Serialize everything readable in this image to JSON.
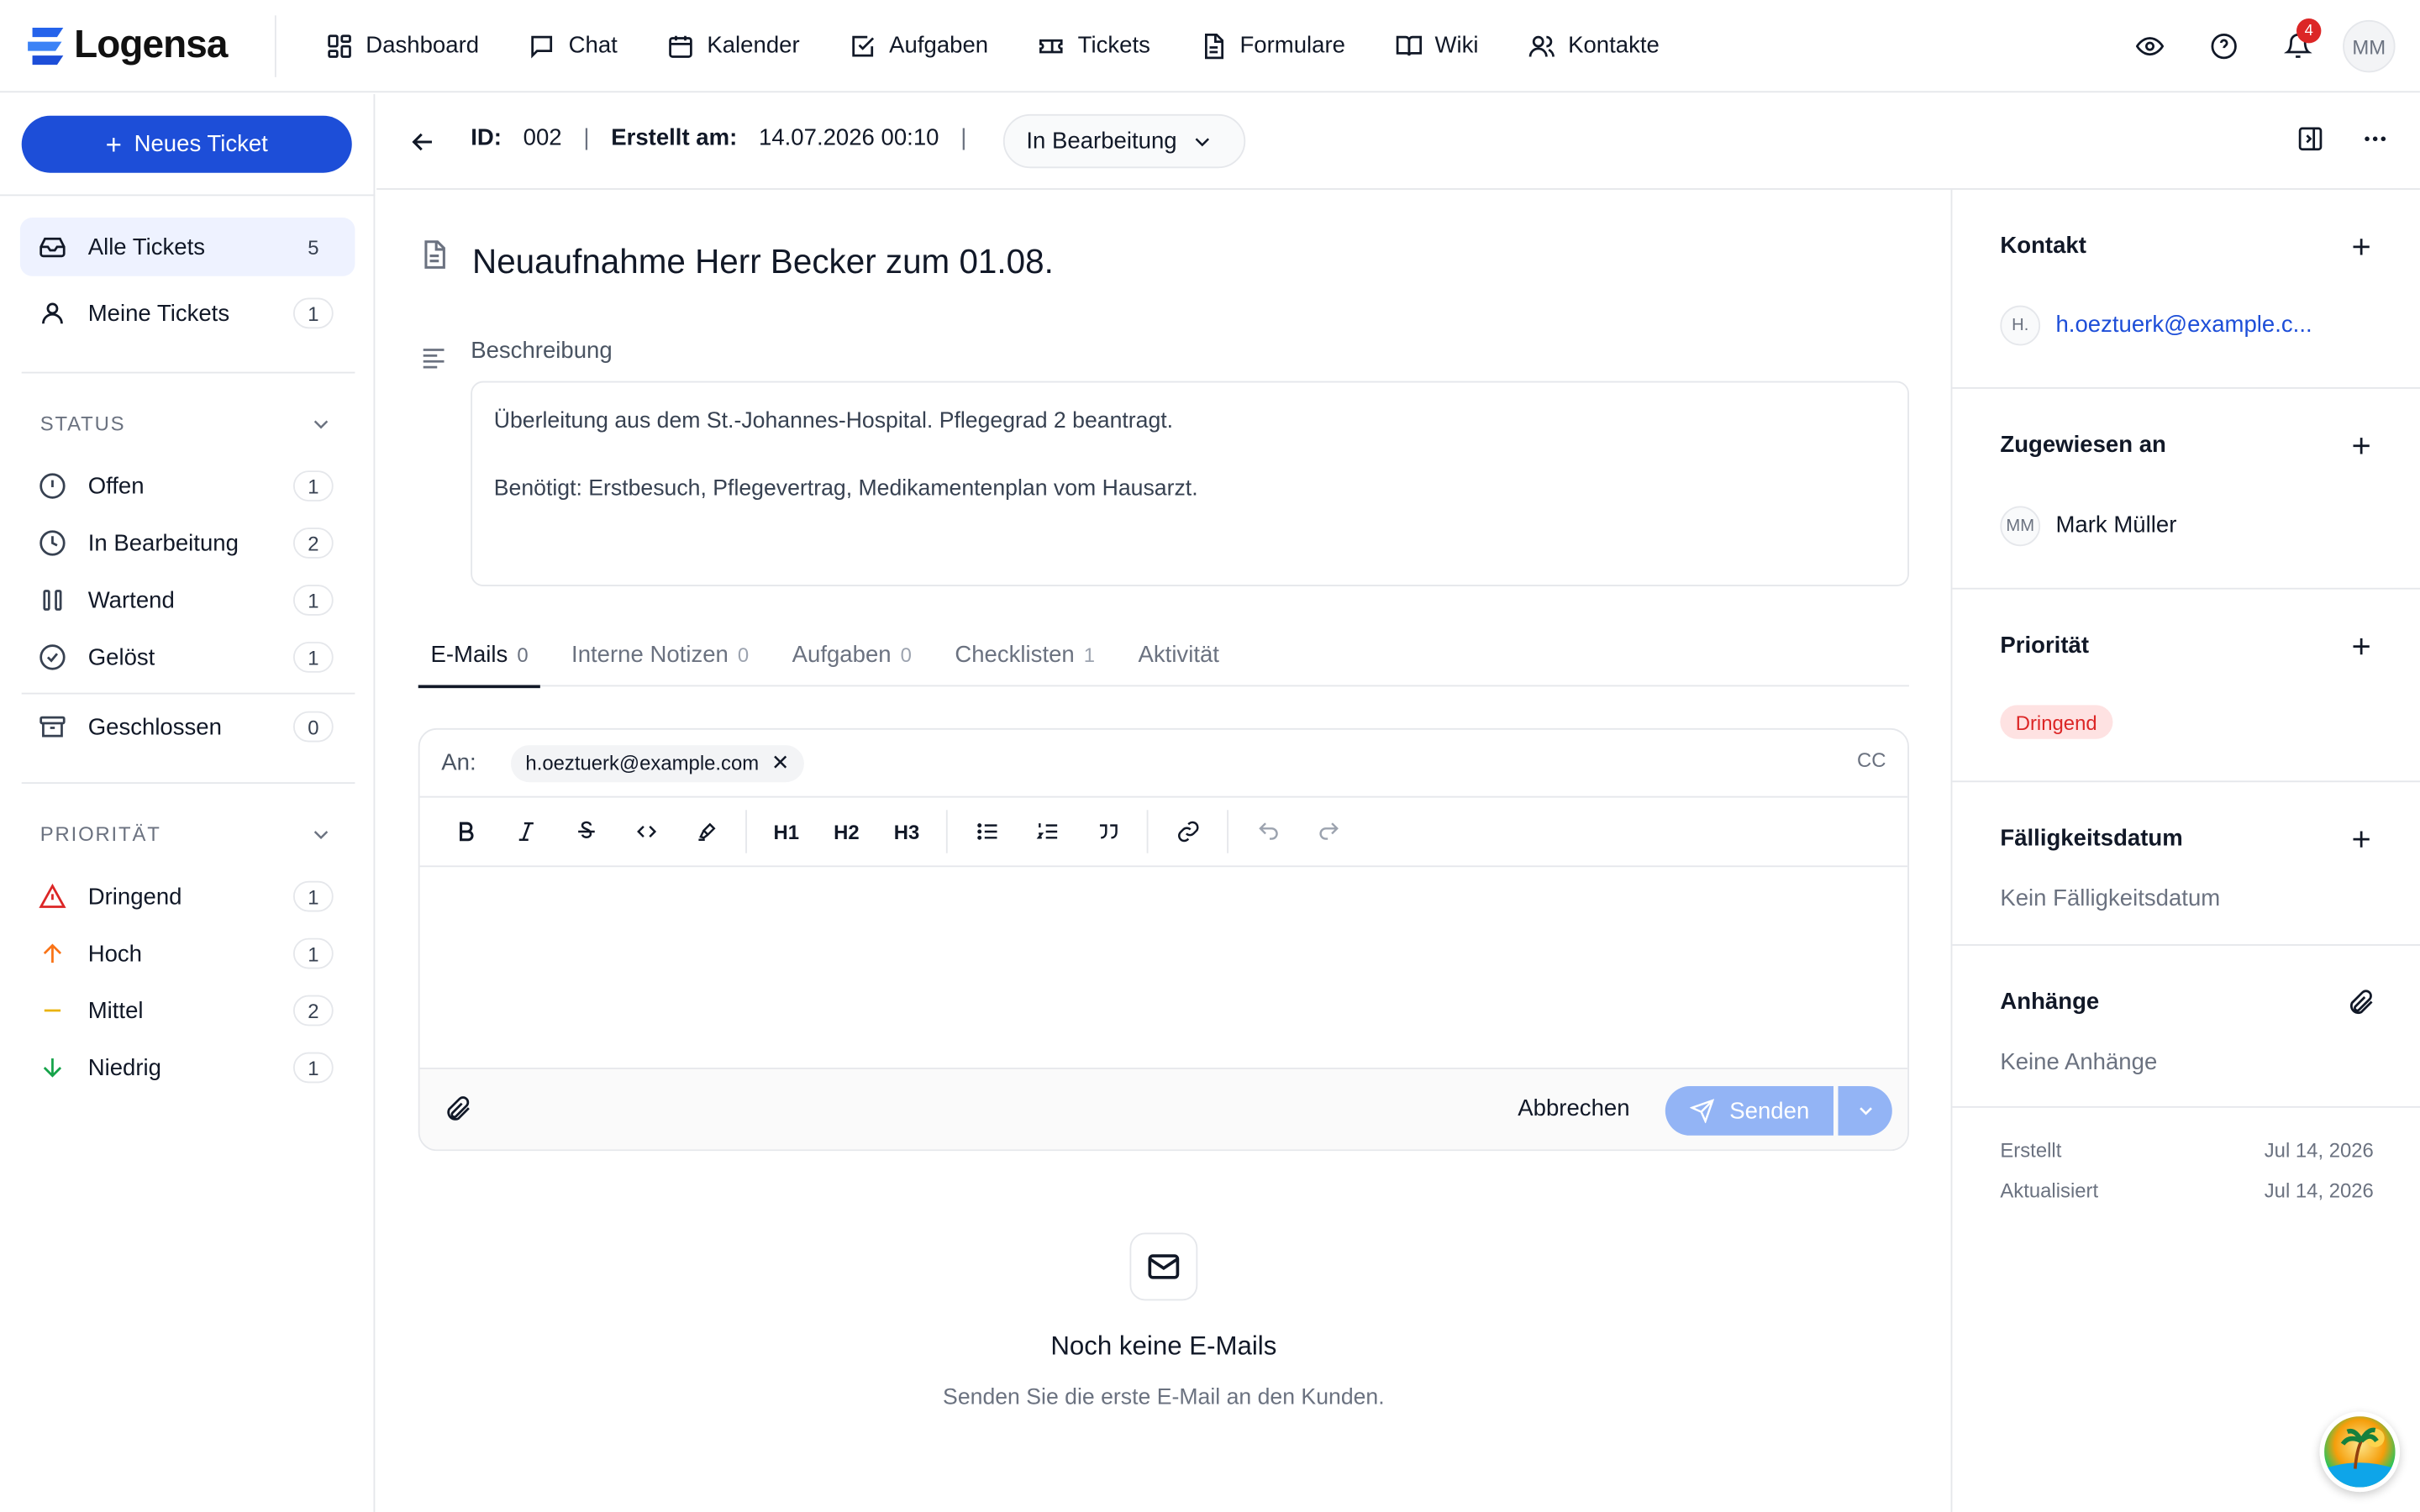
{
  "app": {
    "name": "Logensa",
    "brand_color": "#1d4ed8"
  },
  "nav": [
    {
      "label": "Dashboard",
      "icon": "dashboard-icon"
    },
    {
      "label": "Chat",
      "icon": "chat-icon"
    },
    {
      "label": "Kalender",
      "icon": "calendar-icon"
    },
    {
      "label": "Aufgaben",
      "icon": "task-icon"
    },
    {
      "label": "Tickets",
      "icon": "ticket-icon"
    },
    {
      "label": "Formulare",
      "icon": "form-icon"
    },
    {
      "label": "Wiki",
      "icon": "book-icon"
    },
    {
      "label": "Kontakte",
      "icon": "contacts-icon"
    }
  ],
  "topbar": {
    "notifications": "4",
    "user_initials": "MM"
  },
  "sidebar": {
    "new_ticket_label": "Neues Ticket",
    "views": [
      {
        "label": "Alle Tickets",
        "count": "5"
      },
      {
        "label": "Meine Tickets",
        "count": "1"
      }
    ],
    "status_heading": "STATUS",
    "status": [
      {
        "label": "Offen",
        "count": "1"
      },
      {
        "label": "In Bearbeitung",
        "count": "2"
      },
      {
        "label": "Wartend",
        "count": "1"
      },
      {
        "label": "Gelöst",
        "count": "1"
      },
      {
        "label": "Geschlossen",
        "count": "0"
      }
    ],
    "priority_heading": "PRIORITÄT",
    "priority": [
      {
        "label": "Dringend",
        "count": "1",
        "color": "#dc2626"
      },
      {
        "label": "Hoch",
        "count": "1",
        "color": "#f97316"
      },
      {
        "label": "Mittel",
        "count": "2",
        "color": "#eab308"
      },
      {
        "label": "Niedrig",
        "count": "1",
        "color": "#16a34a"
      }
    ]
  },
  "ticket": {
    "id_label": "ID:",
    "id": "002",
    "created_label": "Erstellt am:",
    "created": "14.07.2026 00:10",
    "status": "In Bearbeitung",
    "title": "Neuaufnahme Herr Becker zum 01.08.",
    "description_label": "Beschreibung",
    "description_line1": "Überleitung aus dem St.-Johannes-Hospital. Pflegegrad 2 beantragt.",
    "description_line2": "Benötigt: Erstbesuch, Pflegevertrag, Medikamentenplan vom Hausarzt."
  },
  "tabs": [
    {
      "label": "E-Mails",
      "count": "0"
    },
    {
      "label": "Interne Notizen",
      "count": "0"
    },
    {
      "label": "Aufgaben",
      "count": "0"
    },
    {
      "label": "Checklisten",
      "count": "1"
    },
    {
      "label": "Aktivität",
      "count": ""
    }
  ],
  "composer": {
    "to_label": "An:",
    "recipient": "h.oeztuerk@example.com",
    "cc_label": "CC",
    "toolbar": {
      "h1": "H1",
      "h2": "H2",
      "h3": "H3"
    },
    "cancel_label": "Abbrechen",
    "send_label": "Senden"
  },
  "empty": {
    "title": "Noch keine E-Mails",
    "subtitle": "Senden Sie die erste E-Mail an den Kunden."
  },
  "panel": {
    "contact_title": "Kontakt",
    "contact_initials": "H.",
    "contact_email": "h.oeztuerk@example.c...",
    "assigned_title": "Zugewiesen an",
    "assignee_initials": "MM",
    "assignee": "Mark Müller",
    "priority_title": "Priorität",
    "priority": "Dringend",
    "due_title": "Fälligkeitsdatum",
    "due_value": "Kein Fälligkeitsdatum",
    "attachments_title": "Anhänge",
    "attachments_value": "Keine Anhänge",
    "created_label": "Erstellt",
    "created_value": "Jul 14, 2026",
    "updated_label": "Aktualisiert",
    "updated_value": "Jul 14, 2026"
  }
}
